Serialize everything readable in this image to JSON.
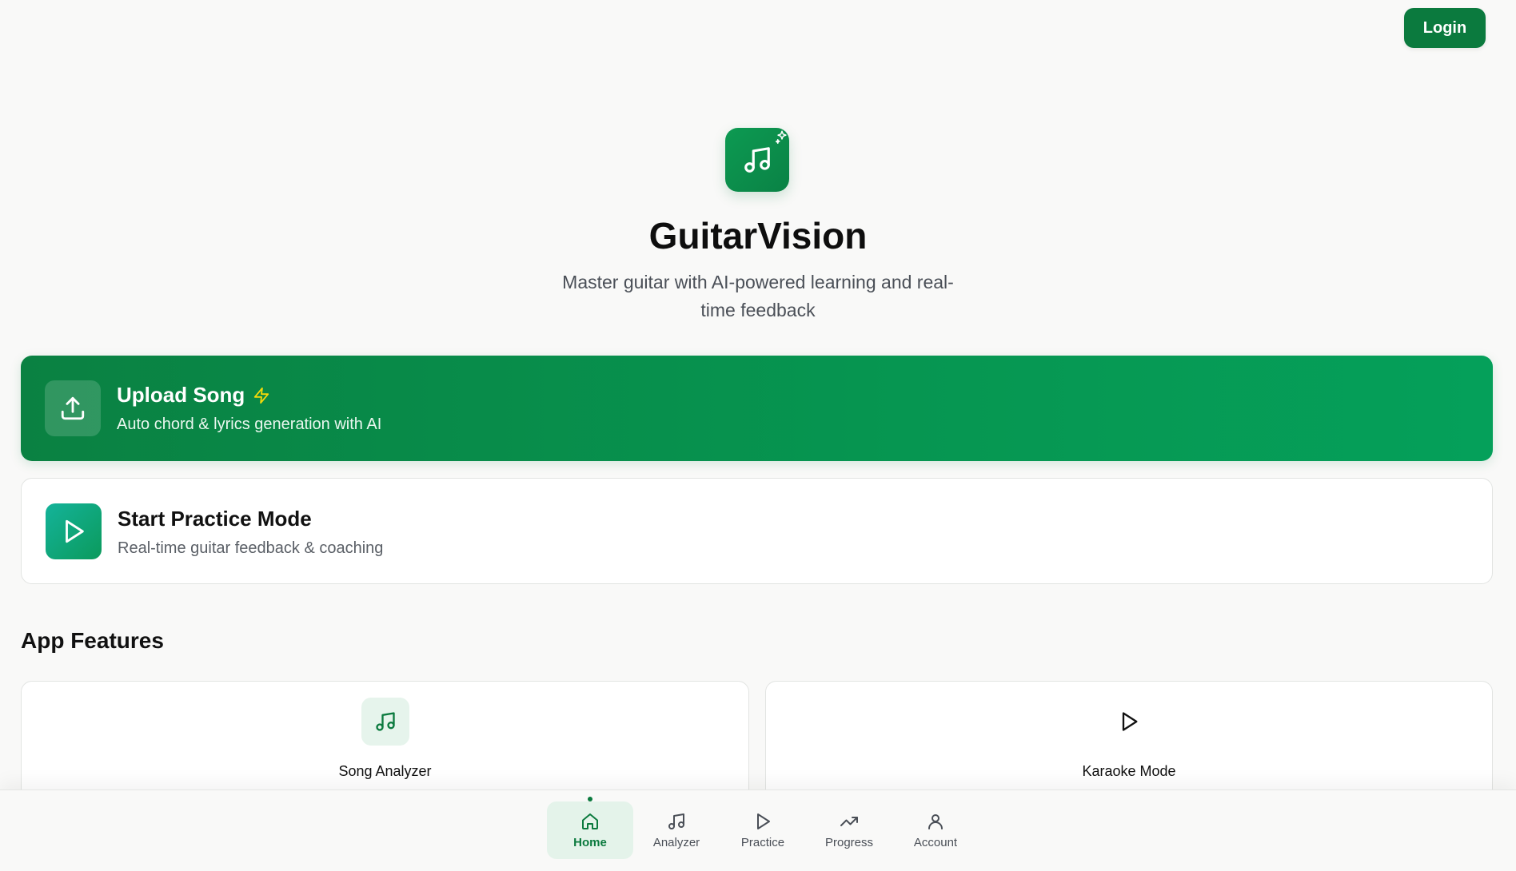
{
  "header": {
    "login_label": "Login"
  },
  "hero": {
    "title": "GuitarVision",
    "subtitle": "Master guitar with AI-powered learning and real-time feedback"
  },
  "upload": {
    "title": "Upload Song",
    "description": "Auto chord & lyrics generation with AI"
  },
  "practice": {
    "title": "Start Practice Mode",
    "description": "Real-time guitar feedback & coaching"
  },
  "features": {
    "heading": "App Features",
    "items": [
      {
        "label": "Song Analyzer",
        "icon": "music-note-icon"
      },
      {
        "label": "Karaoke Mode",
        "icon": "play-icon"
      }
    ]
  },
  "nav": {
    "items": [
      {
        "label": "Home",
        "icon": "home-icon",
        "active": true
      },
      {
        "label": "Analyzer",
        "icon": "music-note-icon"
      },
      {
        "label": "Practice",
        "icon": "play-icon"
      },
      {
        "label": "Progress",
        "icon": "trending-up-icon"
      },
      {
        "label": "Account",
        "icon": "user-icon"
      }
    ]
  },
  "colors": {
    "brand": "#0b7a3e",
    "brand_gradient_end": "#05a05a",
    "accent_bolt": "#f5d90a",
    "background": "#f9f9f8"
  }
}
